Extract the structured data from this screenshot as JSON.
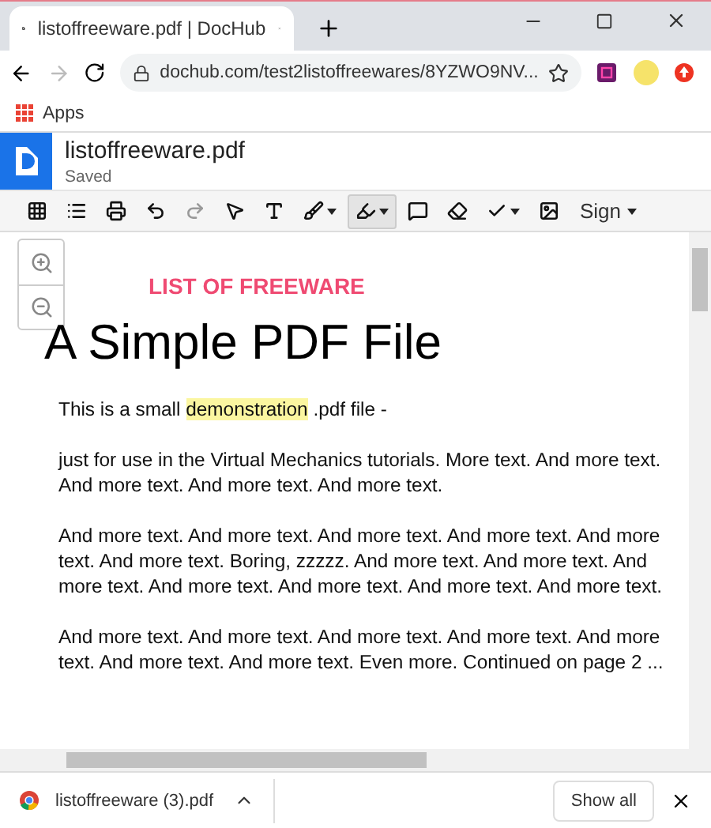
{
  "tab": {
    "title": "listoffreeware.pdf | DocHub"
  },
  "address": {
    "url": "dochub.com/test2listoffreewares/8YZWO9NV..."
  },
  "bookmarks": [
    {
      "label": "Apps"
    }
  ],
  "document": {
    "name": "listoffreeware.pdf",
    "status": "Saved"
  },
  "tools": [
    {
      "kind": "grid",
      "selected": false,
      "menu": false
    },
    {
      "kind": "list",
      "selected": false,
      "menu": false
    },
    {
      "kind": "print",
      "selected": false,
      "menu": false
    },
    {
      "kind": "undo",
      "selected": false,
      "menu": false
    },
    {
      "kind": "redo",
      "selected": false,
      "menu": false
    },
    {
      "kind": "pointer",
      "selected": false,
      "menu": false
    },
    {
      "kind": "text",
      "selected": false,
      "menu": false
    },
    {
      "kind": "brush",
      "selected": false,
      "menu": true
    },
    {
      "kind": "highlighter",
      "selected": true,
      "menu": true
    },
    {
      "kind": "comment",
      "selected": false,
      "menu": false
    },
    {
      "kind": "eraser",
      "selected": false,
      "menu": false
    },
    {
      "kind": "check",
      "selected": false,
      "menu": true
    },
    {
      "kind": "image",
      "selected": false,
      "menu": false
    }
  ],
  "sign": {
    "label": "Sign"
  },
  "page": {
    "header": "LIST OF FREEWARE",
    "title": "A Simple PDF File",
    "paragraphs": [
      {
        "before": "This is a small ",
        "highlight": "demonstration",
        "after": " .pdf file -"
      },
      {
        "before": "just for use in the Virtual Mechanics tutorials. More text. And more text. And more text. And more text. And more text."
      },
      {
        "before": "And more text. And more text. And more text. And more text. And more text. And more text. Boring, zzzzz. And more text. And more text. And more text. And more text. And more text. And more text. And more text."
      },
      {
        "before": "And more text. And more text. And more text. And more text. And more text. And more text. And more text. Even more. Continued on page 2 ..."
      }
    ]
  },
  "downloads": [
    {
      "file": "listoffreeware (3).pdf"
    }
  ],
  "show_all": "Show all"
}
